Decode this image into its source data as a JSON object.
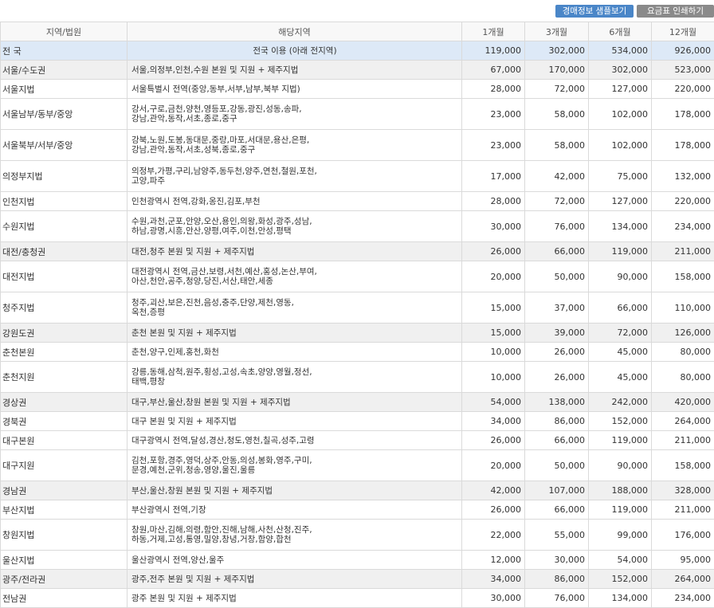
{
  "buttons": {
    "sample": "경매정보 샘플보기",
    "print": "요금표 인쇄하기"
  },
  "headers": [
    "지역/법원",
    "해당지역",
    "1개월",
    "3개월",
    "6개월",
    "12개월"
  ],
  "rows": [
    {
      "region": "전 국",
      "area": "전국 이용 (아래 전지역)",
      "m1": "119,000",
      "m3": "302,000",
      "m6": "534,000",
      "m12": "926,000",
      "style": "nat",
      "lines": 1
    },
    {
      "region": "서울/수도권",
      "area": "서울,의정부,인천,수원 본원 및 지원 + 제주지법",
      "m1": "67,000",
      "m3": "170,000",
      "m6": "302,000",
      "m12": "523,000",
      "style": "hl",
      "lines": 1
    },
    {
      "region": "서울지법",
      "area": "서울특별시 전역(중앙,동부,서부,남부,북부 지법)",
      "m1": "28,000",
      "m3": "72,000",
      "m6": "127,000",
      "m12": "220,000",
      "style": "",
      "lines": 1
    },
    {
      "region": "서울남부/동부/중앙",
      "area": "강서,구로,금천,양천,영등포,강동,광진,성동,송파,\n강남,관악,동작,서초,종로,중구",
      "m1": "23,000",
      "m3": "58,000",
      "m6": "102,000",
      "m12": "178,000",
      "style": "",
      "lines": 2
    },
    {
      "region": "서울북부/서부/중앙",
      "area": "강북,노원,도봉,동대문,중랑,마포,서대문,용산,은평,\n강남,관악,동작,서초,성북,종로,중구",
      "m1": "23,000",
      "m3": "58,000",
      "m6": "102,000",
      "m12": "178,000",
      "style": "",
      "lines": 2
    },
    {
      "region": "의정부지법",
      "area": "의정부,가평,구리,남양주,동두천,양주,연천,철원,포천,\n고양,파주",
      "m1": "17,000",
      "m3": "42,000",
      "m6": "75,000",
      "m12": "132,000",
      "style": "",
      "lines": 2
    },
    {
      "region": "인천지법",
      "area": "인천광역시 전역,강화,옹진,김포,부천",
      "m1": "28,000",
      "m3": "72,000",
      "m6": "127,000",
      "m12": "220,000",
      "style": "",
      "lines": 1
    },
    {
      "region": "수원지법",
      "area": "수원,과천,군포,안양,오산,용인,의왕,화성,광주,성남,\n하남,광명,시흥,안산,양평,여주,이천,안성,평택",
      "m1": "30,000",
      "m3": "76,000",
      "m6": "134,000",
      "m12": "234,000",
      "style": "",
      "lines": 2
    },
    {
      "region": "대전/충청권",
      "area": "대전,청주 본원 및 지원 + 제주지법",
      "m1": "26,000",
      "m3": "66,000",
      "m6": "119,000",
      "m12": "211,000",
      "style": "hl",
      "lines": 1
    },
    {
      "region": "대전지법",
      "area": "대전광역시 전역,금산,보령,서천,예산,홍성,논산,부여,\n아산,천안,공주,청양,당진,서산,태안,세종",
      "m1": "20,000",
      "m3": "50,000",
      "m6": "90,000",
      "m12": "158,000",
      "style": "",
      "lines": 2
    },
    {
      "region": "청주지법",
      "area": "청주,괴산,보은,진천,음성,충주,단양,제천,영동,\n옥천,증평",
      "m1": "15,000",
      "m3": "37,000",
      "m6": "66,000",
      "m12": "110,000",
      "style": "",
      "lines": 2
    },
    {
      "region": "강원도권",
      "area": "춘천 본원 및 지원 + 제주지법",
      "m1": "15,000",
      "m3": "39,000",
      "m6": "72,000",
      "m12": "126,000",
      "style": "hl",
      "lines": 1
    },
    {
      "region": "춘천본원",
      "area": "춘천,양구,인제,홍천,화천",
      "m1": "10,000",
      "m3": "26,000",
      "m6": "45,000",
      "m12": "80,000",
      "style": "",
      "lines": 1
    },
    {
      "region": "춘천지원",
      "area": "강릉,동해,삼척,원주,횡성,고성,속초,양양,영월,정선,\n태백,평창",
      "m1": "10,000",
      "m3": "26,000",
      "m6": "45,000",
      "m12": "80,000",
      "style": "",
      "lines": 2
    },
    {
      "region": "경상권",
      "area": "대구,부산,울산,창원 본원 및 지원 + 제주지법",
      "m1": "54,000",
      "m3": "138,000",
      "m6": "242,000",
      "m12": "420,000",
      "style": "hl",
      "lines": 1
    },
    {
      "region": "경북권",
      "area": "대구 본원 및 지원 + 제주지법",
      "m1": "34,000",
      "m3": "86,000",
      "m6": "152,000",
      "m12": "264,000",
      "style": "",
      "lines": 1
    },
    {
      "region": "대구본원",
      "area": "대구광역시 전역,달성,경산,청도,영천,칠곡,성주,고령",
      "m1": "26,000",
      "m3": "66,000",
      "m6": "119,000",
      "m12": "211,000",
      "style": "",
      "lines": 1
    },
    {
      "region": "대구지원",
      "area": "김천,포항,경주,영덕,상주,안동,의성,봉화,영주,구미,\n문경,예천,군위,청송,영양,울진,울릉",
      "m1": "20,000",
      "m3": "50,000",
      "m6": "90,000",
      "m12": "158,000",
      "style": "",
      "lines": 2
    },
    {
      "region": "경남권",
      "area": "부산,울산,창원 본원 및 지원 + 제주지법",
      "m1": "42,000",
      "m3": "107,000",
      "m6": "188,000",
      "m12": "328,000",
      "style": "hl",
      "lines": 1
    },
    {
      "region": "부산지법",
      "area": "부산광역시 전역,기장",
      "m1": "26,000",
      "m3": "66,000",
      "m6": "119,000",
      "m12": "211,000",
      "style": "",
      "lines": 1
    },
    {
      "region": "창원지법",
      "area": "창원,마산,김해,의령,함안,진해,남해,사천,산청,진주,\n하동,거제,고성,통영,밀양,창녕,거창,함양,합천",
      "m1": "22,000",
      "m3": "55,000",
      "m6": "99,000",
      "m12": "176,000",
      "style": "",
      "lines": 2
    },
    {
      "region": "울산지법",
      "area": "울산광역시 전역,양산,울주",
      "m1": "12,000",
      "m3": "30,000",
      "m6": "54,000",
      "m12": "95,000",
      "style": "",
      "lines": 1
    },
    {
      "region": "광주/전라권",
      "area": "광주,전주 본원 및 지원 + 제주지법",
      "m1": "34,000",
      "m3": "86,000",
      "m6": "152,000",
      "m12": "264,000",
      "style": "hl",
      "lines": 1
    },
    {
      "region": "전남권",
      "area": "광주 본원 및 지원 + 제주지법",
      "m1": "30,000",
      "m3": "76,000",
      "m6": "134,000",
      "m12": "234,000",
      "style": "",
      "lines": 1
    }
  ]
}
